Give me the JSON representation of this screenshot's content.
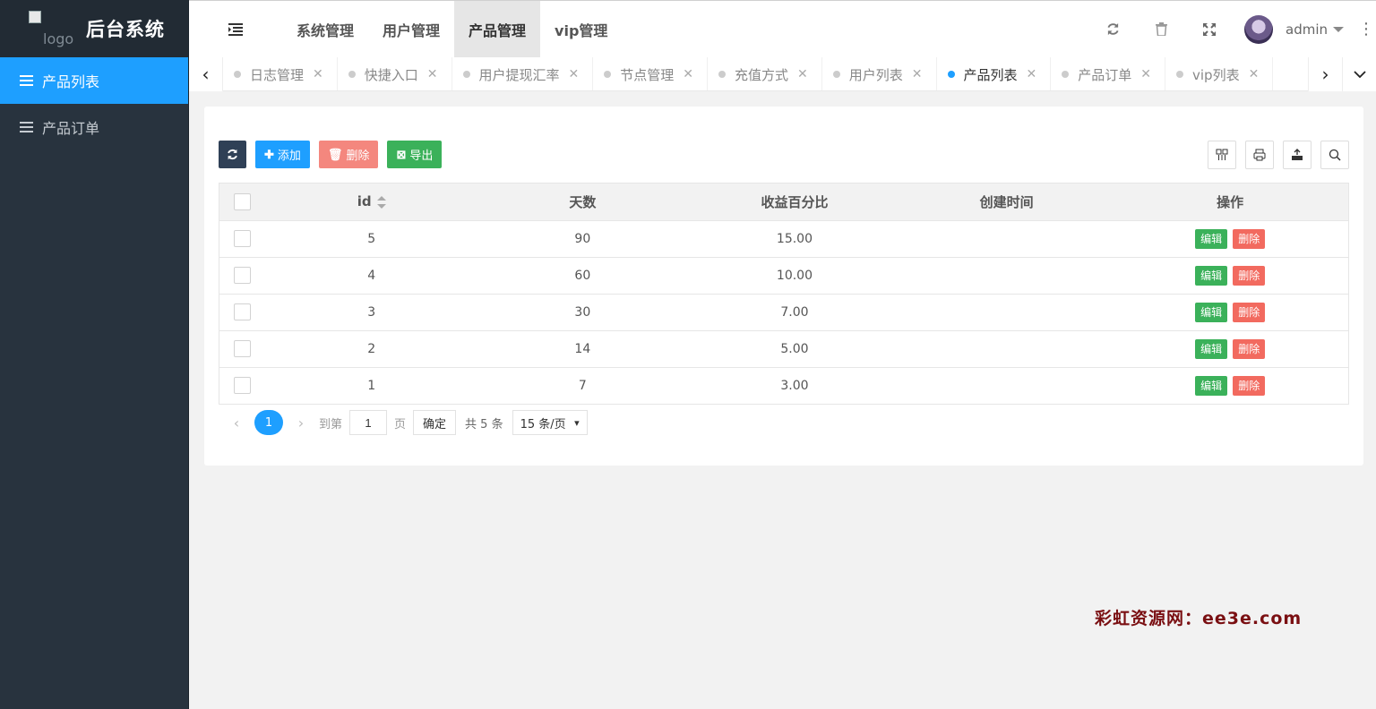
{
  "sidebar": {
    "logo_alt": "logo",
    "title": "后台系统",
    "items": [
      {
        "label": "产品列表",
        "icon": "list-icon",
        "active": true
      },
      {
        "label": "产品订单",
        "icon": "list-icon",
        "active": false
      }
    ]
  },
  "header": {
    "menu_icon": "indent-icon",
    "nav": [
      {
        "label": "系统管理"
      },
      {
        "label": "用户管理"
      },
      {
        "label": "产品管理",
        "active": true
      },
      {
        "label": "vip管理"
      }
    ],
    "user_name": "admin"
  },
  "tabs": [
    {
      "label": "日志管理"
    },
    {
      "label": "快捷入口"
    },
    {
      "label": "用户提现汇率"
    },
    {
      "label": "节点管理"
    },
    {
      "label": "充值方式"
    },
    {
      "label": "用户列表"
    },
    {
      "label": "产品列表",
      "active": true
    },
    {
      "label": "产品订单"
    },
    {
      "label": "vip列表"
    }
  ],
  "toolbar": {
    "add_label": "添加",
    "delete_label": "删除",
    "export_label": "导出"
  },
  "table": {
    "headers": [
      "id",
      "天数",
      "收益百分比",
      "创建时间",
      "操作"
    ],
    "rows": [
      {
        "id": "5",
        "days": "90",
        "rate": "15.00",
        "created": "",
        "edit": "编辑",
        "del": "删除"
      },
      {
        "id": "4",
        "days": "60",
        "rate": "10.00",
        "created": "",
        "edit": "编辑",
        "del": "删除"
      },
      {
        "id": "3",
        "days": "30",
        "rate": "7.00",
        "created": "",
        "edit": "编辑",
        "del": "删除"
      },
      {
        "id": "2",
        "days": "14",
        "rate": "5.00",
        "created": "",
        "edit": "编辑",
        "del": "删除"
      },
      {
        "id": "1",
        "days": "7",
        "rate": "3.00",
        "created": "",
        "edit": "编辑",
        "del": "删除"
      }
    ]
  },
  "pager": {
    "current": "1",
    "goto_label": "到第",
    "page_value": "1",
    "page_unit": "页",
    "confirm": "确定",
    "total": "共 5 条",
    "page_size": "15 条/页"
  },
  "watermark": "彩虹资源网：ee3e.com",
  "colors": {
    "sidebar_bg": "#28333e",
    "accent": "#1e9fff",
    "success": "#3bb15a",
    "danger": "#f26a5f"
  }
}
